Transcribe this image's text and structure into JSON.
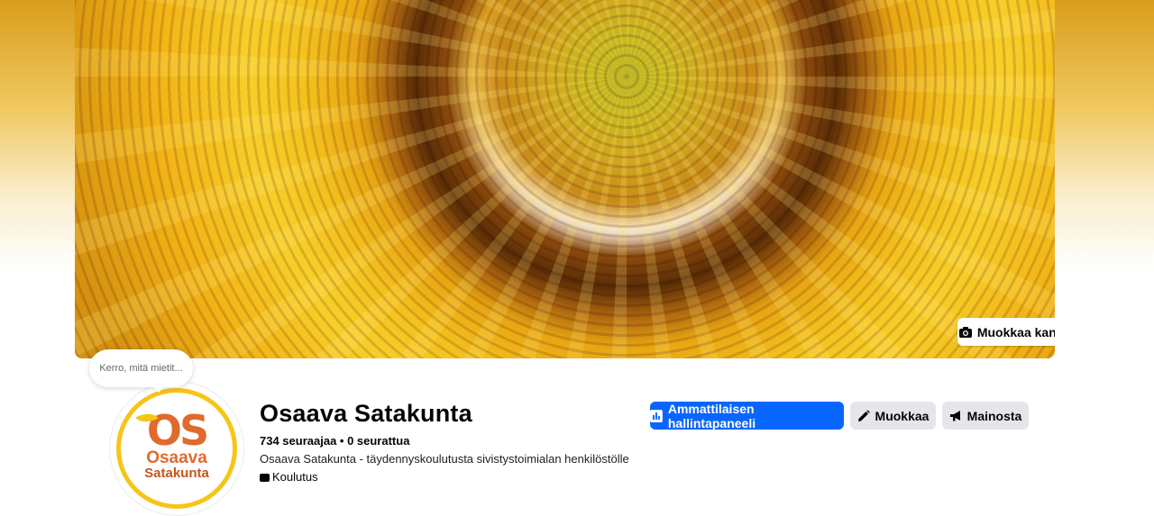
{
  "cover": {
    "edit_label": "Muokkaa kansikuvaa",
    "icon": "camera-icon"
  },
  "composer_bubble": {
    "text": "Kerro, mitä mietit..."
  },
  "avatar": {
    "logo_letters": "OS",
    "logo_word1": "Osaava",
    "logo_word2": "Satakunta",
    "ring_color": "#f5c518",
    "text_color": "#e06a2c"
  },
  "profile": {
    "name": "Osaava Satakunta",
    "followers_line": "734 seuraajaa • 0 seurattua",
    "description": "Osaava Satakunta - täydennyskoulutusta sivistystoimialan henkilöstölle",
    "category": "Koulutus"
  },
  "actions": {
    "dashboard_label": "Ammattilaisen hallintapaneeli",
    "edit_label": "Muokkaa",
    "promote_label": "Mainosta"
  },
  "colors": {
    "primary": "#0866ff",
    "secondary_bg": "#e4e6eb",
    "text": "#050505"
  }
}
